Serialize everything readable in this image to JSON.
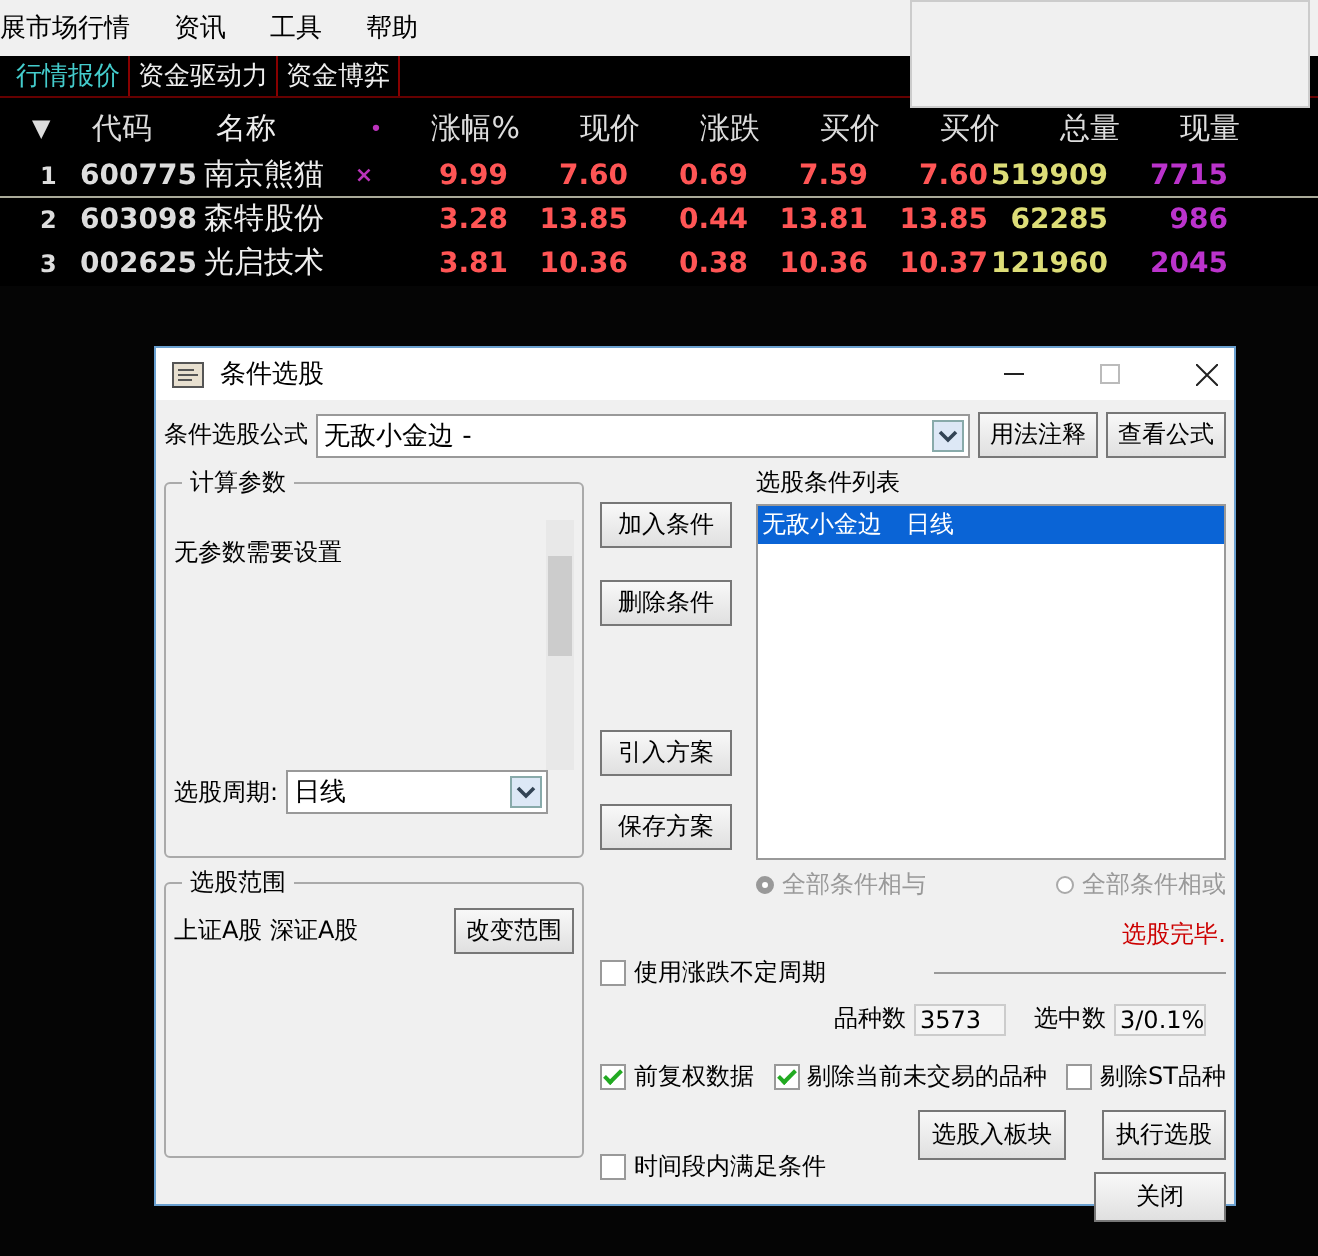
{
  "menu": [
    "展市场行情",
    "资讯",
    "工具",
    "帮助"
  ],
  "market_tabs": [
    {
      "label": "行情报价",
      "selected": true
    },
    {
      "label": "资金驱动力",
      "selected": false
    },
    {
      "label": "资金博弈",
      "selected": false
    }
  ],
  "quote_table": {
    "columns": [
      "▼",
      "代码",
      "名称",
      "•",
      "涨幅%",
      "现价",
      "涨跌",
      "买价",
      "买价",
      "总量",
      "现量"
    ],
    "rows": [
      {
        "index": "1",
        "code": "600775",
        "name": "南京熊猫",
        "flag": "×",
        "change_pct": "9.99",
        "price": "7.60",
        "change": "0.69",
        "bid": "7.59",
        "ask": "7.60",
        "volume": "519909",
        "last_volume": "7715",
        "selected": true
      },
      {
        "index": "2",
        "code": "603098",
        "name": "森特股份",
        "change_pct": "3.28",
        "price": "13.85",
        "change": "0.44",
        "bid": "13.81",
        "ask": "13.85",
        "volume": "62285",
        "last_volume": "986",
        "selected": false
      },
      {
        "index": "3",
        "code": "002625",
        "name": "光启技术",
        "change_pct": "3.81",
        "price": "10.36",
        "change": "0.38",
        "bid": "10.36",
        "ask": "10.37",
        "volume": "121960",
        "last_volume": "2045",
        "selected": false
      }
    ]
  },
  "dialog": {
    "title": "条件选股",
    "formula_label": "条件选股公式",
    "formula_value": "无敌小金边 -",
    "formula_buttons": [
      "用法注释",
      "查看公式"
    ],
    "params_group": "计算参数",
    "params_text": "无参数需要设置",
    "period_label": "选股周期:",
    "period_value": "日线",
    "middle_buttons": [
      "加入条件",
      "删除条件",
      "引入方案",
      "保存方案"
    ],
    "list_label": "选股条件列表",
    "list_items": [
      {
        "text": "无敌小金边　日线",
        "selected": true
      }
    ],
    "radios": [
      {
        "label": "全部条件相与",
        "selected": true
      },
      {
        "label": "全部条件相或",
        "selected": false
      }
    ],
    "status": "选股完毕.",
    "range_group": "选股范围",
    "range_text": "上证A股 深证A股",
    "range_button": "改变范围",
    "period_check": {
      "label": "使用涨跌不定周期",
      "checked": false
    },
    "count_label": "品种数",
    "count_value": "3573",
    "selected_label": "选中数",
    "selected_value": "3/0.1%",
    "options": [
      {
        "label": "前复权数据",
        "checked": true
      },
      {
        "label": "剔除当前未交易的品种",
        "checked": true
      },
      {
        "label": "剔除ST品种",
        "checked": false
      }
    ],
    "time_check": {
      "label": "时间段内满足条件",
      "checked": false
    },
    "action_buttons": [
      "选股入板块",
      "执行选股",
      "关闭"
    ]
  }
}
